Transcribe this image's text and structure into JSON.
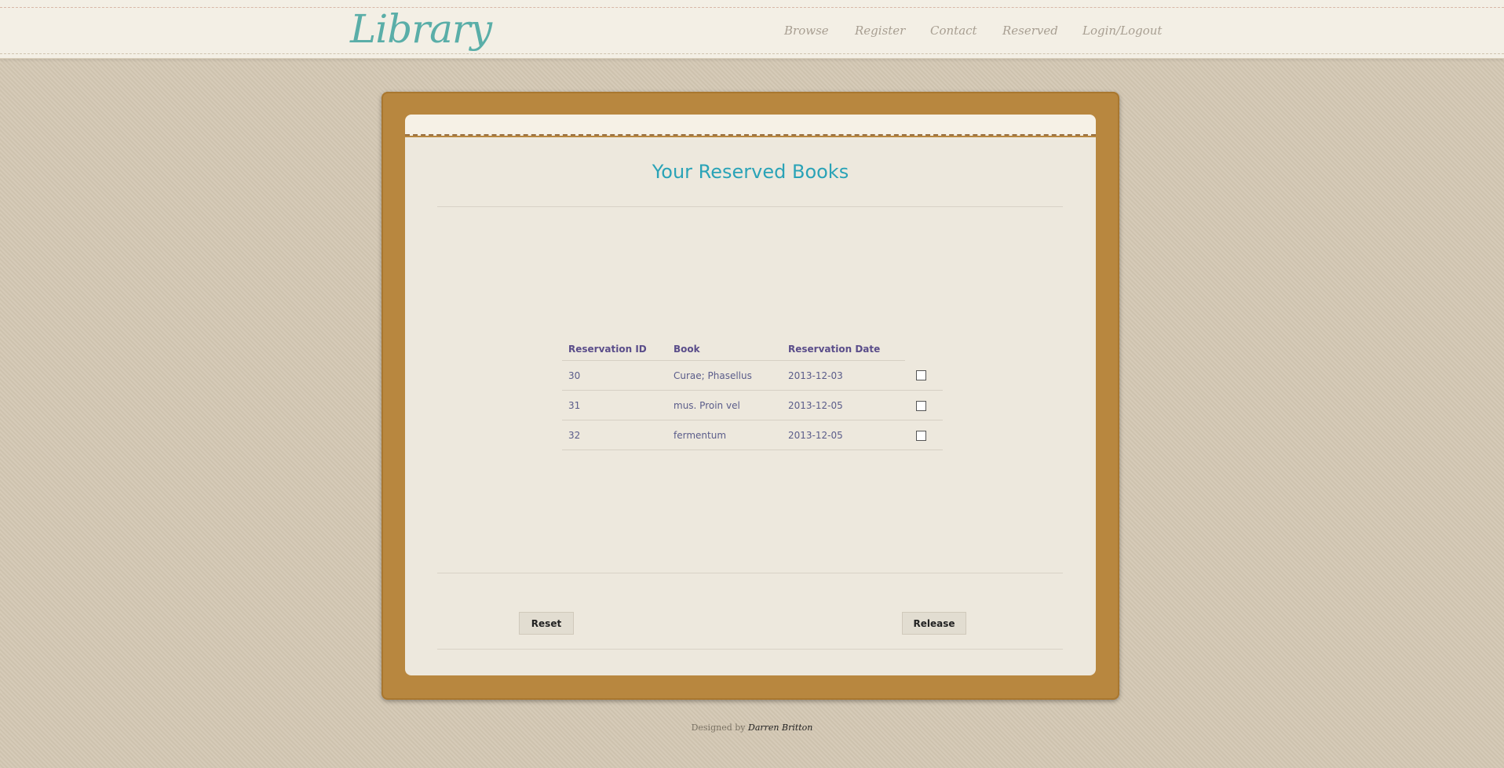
{
  "header": {
    "logo": "Library",
    "nav": [
      {
        "label": "Browse"
      },
      {
        "label": "Register"
      },
      {
        "label": "Contact"
      },
      {
        "label": "Reserved"
      },
      {
        "label": "Login/Logout"
      }
    ]
  },
  "main": {
    "title": "Your Reserved Books",
    "table": {
      "headers": [
        "Reservation ID",
        "Book",
        "Reservation Date"
      ],
      "rows": [
        {
          "id": "30",
          "book": "Curae; Phasellus",
          "date": "2013-12-03",
          "checked": false
        },
        {
          "id": "31",
          "book": "mus. Proin vel",
          "date": "2013-12-05",
          "checked": false
        },
        {
          "id": "32",
          "book": "fermentum",
          "date": "2013-12-05",
          "checked": false
        }
      ]
    },
    "reset_label": "Reset",
    "release_label": "Release"
  },
  "footer": {
    "prefix": "Designed by",
    "author": "Darren Britton"
  },
  "colors": {
    "logo": "#5aaea8",
    "title": "#2aa3b7",
    "board": "#b8873f",
    "paper": "#ede8dd",
    "table_text": "#5a5c8a"
  }
}
